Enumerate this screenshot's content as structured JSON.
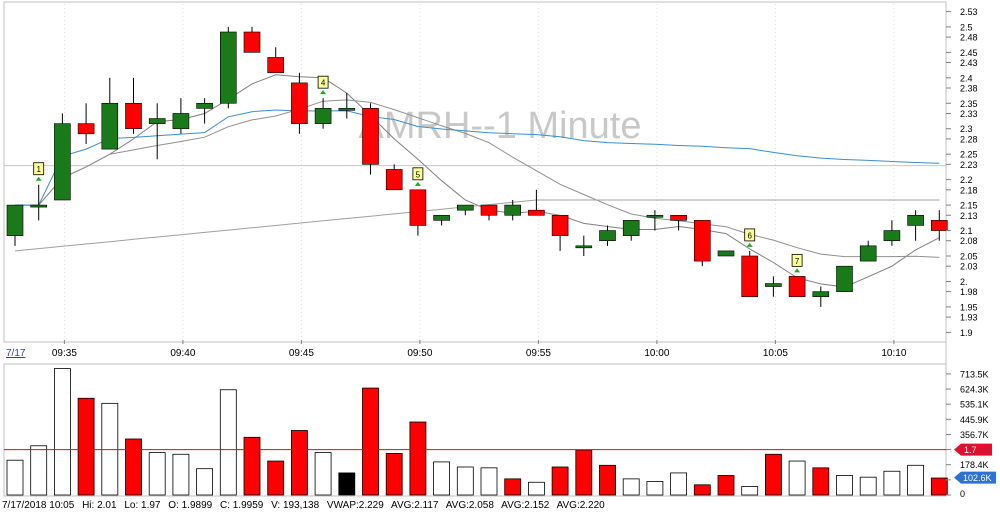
{
  "chart_data": [
    {
      "type": "candlestick",
      "title": "AMRH--1 Minute",
      "date_label": "7/17",
      "x_ticks": [
        "09:35",
        "09:40",
        "09:45",
        "09:50",
        "09:55",
        "10:00",
        "10:05",
        "10:10"
      ],
      "ylim": [
        1.885,
        2.545
      ],
      "y_ticks": [
        "2.53",
        "2.5",
        "2.48",
        "2.45",
        "2.43",
        "2.4",
        "2.38",
        "2.35",
        "2.33",
        "2.3",
        "2.28",
        "2.25",
        "2.23",
        "2.2",
        "2.18",
        "2.15",
        "2.13",
        "2.1",
        "2.08",
        "2.05",
        "2.03",
        "2.",
        "1.98",
        "1.95",
        "1.93",
        "1.9"
      ],
      "y_tick_values": [
        2.53,
        2.5,
        2.48,
        2.45,
        2.43,
        2.4,
        2.38,
        2.35,
        2.33,
        2.3,
        2.28,
        2.25,
        2.23,
        2.2,
        2.18,
        2.15,
        2.13,
        2.1,
        2.08,
        2.05,
        2.03,
        2.0,
        1.98,
        1.95,
        1.93,
        1.9
      ],
      "colors": {
        "up": "#1a7a1a",
        "down": "#ff0000",
        "grid": "#dddddd",
        "ma_blue": "#3a8fd0",
        "ma_gray": "#808080",
        "ref_line": "#c8c8c8"
      },
      "candles": [
        {
          "time": "09:33",
          "o": 2.09,
          "h": 2.14,
          "l": 2.07,
          "c": 2.15
        },
        {
          "time": "09:34",
          "o": 2.15,
          "h": 2.19,
          "l": 2.12,
          "c": 2.15
        },
        {
          "time": "09:35",
          "o": 2.16,
          "h": 2.33,
          "l": 2.16,
          "c": 2.31
        },
        {
          "time": "09:36",
          "o": 2.31,
          "h": 2.35,
          "l": 2.27,
          "c": 2.29
        },
        {
          "time": "09:37",
          "o": 2.26,
          "h": 2.4,
          "l": 2.26,
          "c": 2.35
        },
        {
          "time": "09:38",
          "o": 2.35,
          "h": 2.4,
          "l": 2.29,
          "c": 2.3
        },
        {
          "time": "09:39",
          "o": 2.31,
          "h": 2.35,
          "l": 2.24,
          "c": 2.32
        },
        {
          "time": "09:40",
          "o": 2.3,
          "h": 2.36,
          "l": 2.29,
          "c": 2.33
        },
        {
          "time": "09:41",
          "o": 2.34,
          "h": 2.36,
          "l": 2.31,
          "c": 2.35
        },
        {
          "time": "09:42",
          "o": 2.35,
          "h": 2.5,
          "l": 2.34,
          "c": 2.49
        },
        {
          "time": "09:43",
          "o": 2.49,
          "h": 2.5,
          "l": 2.45,
          "c": 2.45
        },
        {
          "time": "09:44",
          "o": 2.44,
          "h": 2.46,
          "l": 2.42,
          "c": 2.41
        },
        {
          "time": "09:45",
          "o": 2.39,
          "h": 2.41,
          "l": 2.29,
          "c": 2.31
        },
        {
          "time": "09:46",
          "o": 2.31,
          "h": 2.36,
          "l": 2.3,
          "c": 2.34
        },
        {
          "time": "09:47",
          "o": 2.34,
          "h": 2.37,
          "l": 2.32,
          "c": 2.34
        },
        {
          "time": "09:48",
          "o": 2.34,
          "h": 2.35,
          "l": 2.21,
          "c": 2.23
        },
        {
          "time": "09:49",
          "o": 2.22,
          "h": 2.23,
          "l": 2.18,
          "c": 2.18
        },
        {
          "time": "09:50",
          "o": 2.18,
          "h": 2.18,
          "l": 2.09,
          "c": 2.11
        },
        {
          "time": "09:51",
          "o": 2.12,
          "h": 2.13,
          "l": 2.11,
          "c": 2.13
        },
        {
          "time": "09:52",
          "o": 2.14,
          "h": 2.15,
          "l": 2.13,
          "c": 2.15
        },
        {
          "time": "09:53",
          "o": 2.15,
          "h": 2.15,
          "l": 2.12,
          "c": 2.13
        },
        {
          "time": "09:54",
          "o": 2.13,
          "h": 2.16,
          "l": 2.12,
          "c": 2.15
        },
        {
          "time": "09:55",
          "o": 2.14,
          "h": 2.18,
          "l": 2.13,
          "c": 2.13
        },
        {
          "time": "09:56",
          "o": 2.13,
          "h": 2.13,
          "l": 2.06,
          "c": 2.09
        },
        {
          "time": "09:57",
          "o": 2.07,
          "h": 2.09,
          "l": 2.05,
          "c": 2.07
        },
        {
          "time": "09:58",
          "o": 2.08,
          "h": 2.11,
          "l": 2.07,
          "c": 2.1
        },
        {
          "time": "09:59",
          "o": 2.09,
          "h": 2.12,
          "l": 2.08,
          "c": 2.12
        },
        {
          "time": "10:00",
          "o": 2.13,
          "h": 2.14,
          "l": 2.1,
          "c": 2.13
        },
        {
          "time": "10:01",
          "o": 2.13,
          "h": 2.13,
          "l": 2.1,
          "c": 2.12
        },
        {
          "time": "10:02",
          "o": 2.12,
          "h": 2.12,
          "l": 2.03,
          "c": 2.04
        },
        {
          "time": "10:03",
          "o": 2.05,
          "h": 2.06,
          "l": 2.05,
          "c": 2.06
        },
        {
          "time": "10:04",
          "o": 2.05,
          "h": 2.06,
          "l": 1.97,
          "c": 1.97
        },
        {
          "time": "10:05",
          "o": 1.99,
          "h": 2.01,
          "l": 1.97,
          "c": 1.9959
        },
        {
          "time": "10:06",
          "o": 2.01,
          "h": 2.01,
          "l": 1.97,
          "c": 1.97
        },
        {
          "time": "10:07",
          "o": 1.97,
          "h": 1.99,
          "l": 1.95,
          "c": 1.98
        },
        {
          "time": "10:08",
          "o": 1.98,
          "h": 2.03,
          "l": 1.98,
          "c": 2.03
        },
        {
          "time": "10:09",
          "o": 2.04,
          "h": 2.08,
          "l": 2.04,
          "c": 2.07
        },
        {
          "time": "10:10",
          "o": 2.08,
          "h": 2.12,
          "l": 2.07,
          "c": 2.1
        },
        {
          "time": "10:11",
          "o": 2.11,
          "h": 2.14,
          "l": 2.08,
          "c": 2.13
        },
        {
          "time": "10:12",
          "o": 2.12,
          "h": 2.14,
          "l": 2.08,
          "c": 2.1
        }
      ],
      "volume": {
        "ylim": [
          0,
          760000
        ],
        "y_ticks": [
          "713.5K",
          "624.3K",
          "535.1K",
          "445.9K",
          "356.7K",
          "267.6K",
          "178.4K",
          "89.2K",
          "0"
        ],
        "y_tick_values": [
          713500,
          624300,
          535100,
          445900,
          356700,
          267600,
          178400,
          89200,
          0
        ],
        "ref_value": 267600,
        "ref_label": "1.7",
        "current_label": "102.6K",
        "values": [
          205000,
          290000,
          745000,
          570000,
          540000,
          330000,
          250000,
          240000,
          155000,
          620000,
          340000,
          200000,
          380000,
          250000,
          130000,
          630000,
          245000,
          430000,
          195000,
          165000,
          160000,
          95000,
          75000,
          165000,
          265000,
          175000,
          95000,
          80000,
          130000,
          60000,
          115000,
          50000,
          240000,
          200000,
          160000,
          115000,
          105000,
          140000,
          175000,
          100000
        ],
        "colors": [
          "hollow",
          "hollow",
          "hollow",
          "red",
          "hollow",
          "red",
          "hollow",
          "hollow",
          "hollow",
          "hollow",
          "red",
          "red",
          "red",
          "hollow",
          "black",
          "red",
          "red",
          "red",
          "hollow",
          "hollow",
          "hollow",
          "red",
          "hollow",
          "red",
          "red",
          "red",
          "hollow",
          "hollow",
          "hollow",
          "red",
          "red",
          "hollow",
          "red",
          "hollow",
          "red",
          "hollow",
          "hollow",
          "hollow",
          "hollow",
          "red"
        ]
      },
      "markers": [
        {
          "label": "1",
          "bar": 1
        },
        {
          "label": "4",
          "bar": 13
        },
        {
          "label": "5",
          "bar": 17
        },
        {
          "label": "6",
          "bar": 31
        },
        {
          "label": "7",
          "bar": 33
        }
      ]
    }
  ],
  "status": {
    "date": "7/17/2018 10:05",
    "hi": "Hi: 2.01",
    "lo": "Lo: 1.97",
    "open": "O: 1.9899",
    "close": "C: 1.9959",
    "vol": "V: 193,138",
    "vwap": "VWAP:2.229",
    "avg1": "AVG:2.117",
    "avg2": "AVG:2.058",
    "avg3": "AVG:2.152",
    "avg4": "AVG:2.220"
  }
}
